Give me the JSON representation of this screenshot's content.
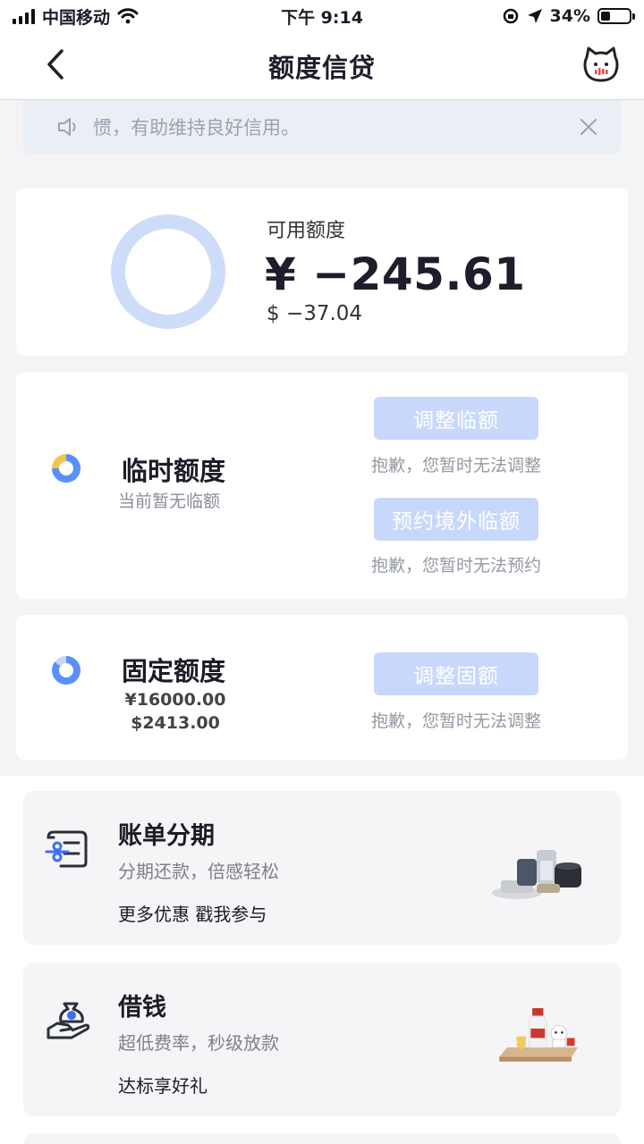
{
  "status_bar": {
    "carrier": "中国移动",
    "time": "下午 9:14",
    "battery": "34%",
    "battery_level": 0.34
  },
  "nav": {
    "title": "额度信贷"
  },
  "notice": {
    "text": "惯，有助维持良好信用。"
  },
  "available": {
    "label": "可用额度",
    "cny": "¥ −245.61",
    "usd": "$ −37.04"
  },
  "temporary": {
    "title": "临时额度",
    "subtitle": "当前暂无临额",
    "adjust_button": "调整临额",
    "adjust_note": "抱歉，您暂时无法调整",
    "reserve_button": "预约境外临额",
    "reserve_note": "抱歉，您暂时无法预约"
  },
  "fixed": {
    "title": "固定额度",
    "cny": "¥16000.00",
    "usd": "$2413.00",
    "adjust_button": "调整固额",
    "adjust_note": "抱歉，您暂时无法调整"
  },
  "promos": [
    {
      "title": "账单分期",
      "subtitle": "分期还款，倍感轻松",
      "link": "更多优惠 戳我参与",
      "icon": "installment-icon"
    },
    {
      "title": "借钱",
      "subtitle": "超低费率，秒级放款",
      "link": "达标享好礼",
      "icon": "money-bag-icon"
    }
  ],
  "colors": {
    "accent_blue": "#5b8ff9",
    "button_disabled": "#c8d8fb",
    "ring": "#cddcf9",
    "pie_yellow": "#f6c44e"
  }
}
